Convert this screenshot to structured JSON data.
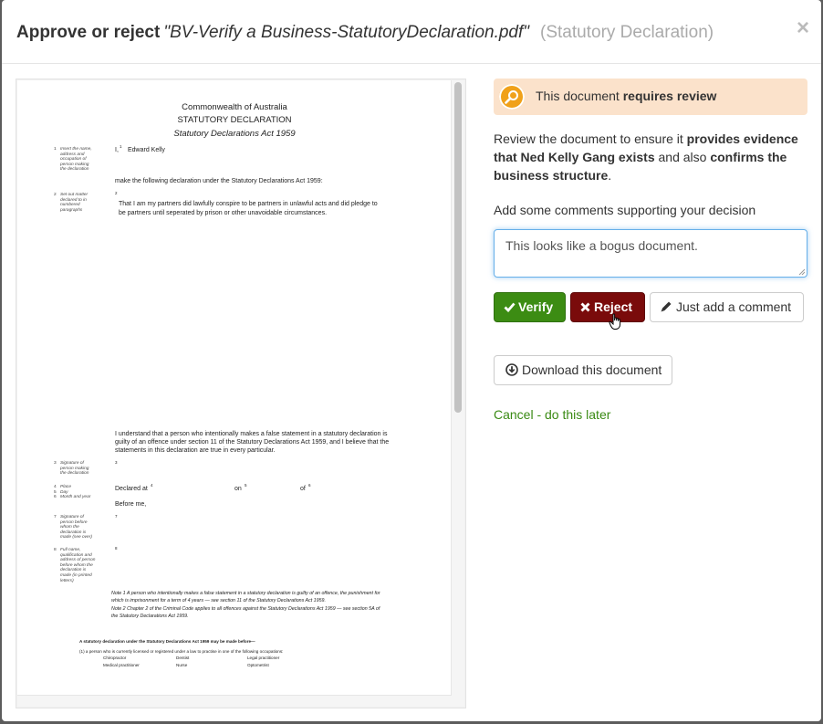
{
  "modal": {
    "title_lead": "Approve or reject",
    "file_name": "\"BV-Verify a Business-StatutoryDeclaration.pdf\"",
    "document_type": "(Statutory Declaration)",
    "close_symbol": "×"
  },
  "document": {
    "heading1": "Commonwealth of Australia",
    "heading2": "STATUTORY DECLARATION",
    "heading3": "Statutory Declarations Act 1959",
    "name_prefix": "I,",
    "name": "Edward Kelly",
    "declaration_intro": "make the following declaration under the Statutory Declarations Act 1959:",
    "statement_line1": "That I am my partners did lawfully conspire to be partners in unlawful acts and did pledge to",
    "statement_line2": "be partners until seperated by prison or other unavoidable circumstances.",
    "understand_line1": "I understand that a person who intentionally makes a false statement in a statutory declaration is",
    "understand_line2": "guilty of an offence under section 11 of the Statutory Declarations Act 1959, and I believe that the",
    "understand_line3": "statements in this declaration are true in every particular.",
    "declared_at": "Declared at",
    "on": "on",
    "of": "of",
    "before_me": "Before me,",
    "side_notes": [
      {
        "num": "1",
        "text": "Insert the name,\naddress and\noccupation of\nperson making\nthe declaration"
      },
      {
        "num": "2",
        "text": "Set out matter\ndeclared to in\nnumbered\nparagraphs"
      },
      {
        "num": "3",
        "text": "Signature of\nperson making\nthe declaration"
      },
      {
        "num": "4\n5\n6",
        "text": "Place\nDay\nMonth and year"
      },
      {
        "num": "7",
        "text": "Signature of\nperson before\nwhom the\ndeclaration is\nmade (see over)"
      },
      {
        "num": "8",
        "text": "Full name,\nqualification and\naddress of person\nbefore whom the\ndeclaration is\nmade (in printed\nletters)"
      }
    ],
    "note1_line1": "Note 1  A person who intentionally makes a false statement in a statutory declaration is guilty of an offence, the punishment for",
    "note1_line2": "which is imprisonment for a term of 4 years — see section 11 of the Statutory Declarations Act 1959.",
    "note2_line1": "Note 2  Chapter 2 of the Criminal Code applies to all offences against the Statutory Declarations Act 1959 — see section 5A of",
    "note2_line2": "the Statutory Declarations Act 1959.",
    "footer_line1": "A statutory declaration under the Statutory Declarations Act 1959 may be made before—",
    "footer_line2": "(1) a person who is currently licensed or registered under a law to practise in one of the following occupations:",
    "occupations": [
      "Chiropractor",
      "Dentist",
      "Legal practitioner",
      "Medical practitioner",
      "Nurse",
      "Optometrist"
    ]
  },
  "panel": {
    "alert_text_prefix": "This document ",
    "alert_text_bold": "requires review",
    "desc_1": "Review the document to ensure it ",
    "desc_2": "provides evidence that Ned Kelly Gang exists",
    "desc_3": " and also ",
    "desc_4": "confirms the business structure",
    "desc_5": ".",
    "comments_label": "Add some comments supporting your decision",
    "comment_value": "This looks like a bogus document.",
    "verify_label": "Verify",
    "reject_label": "Reject",
    "comment_button_label": "Just add a comment",
    "download_label": "Download this document",
    "cancel_label": "Cancel - do this later"
  },
  "colors": {
    "verify": "#3c8c13",
    "reject": "#7a0b0b",
    "alert_bg": "#fbe2cb",
    "alert_icon": "#f0a11a",
    "link": "#3a8a14",
    "focus": "#66afe9"
  },
  "icons": {
    "alert": "magnifier-icon",
    "verify": "check-icon",
    "reject": "times-icon",
    "comment": "pencil-icon",
    "download": "download-circle-icon"
  }
}
